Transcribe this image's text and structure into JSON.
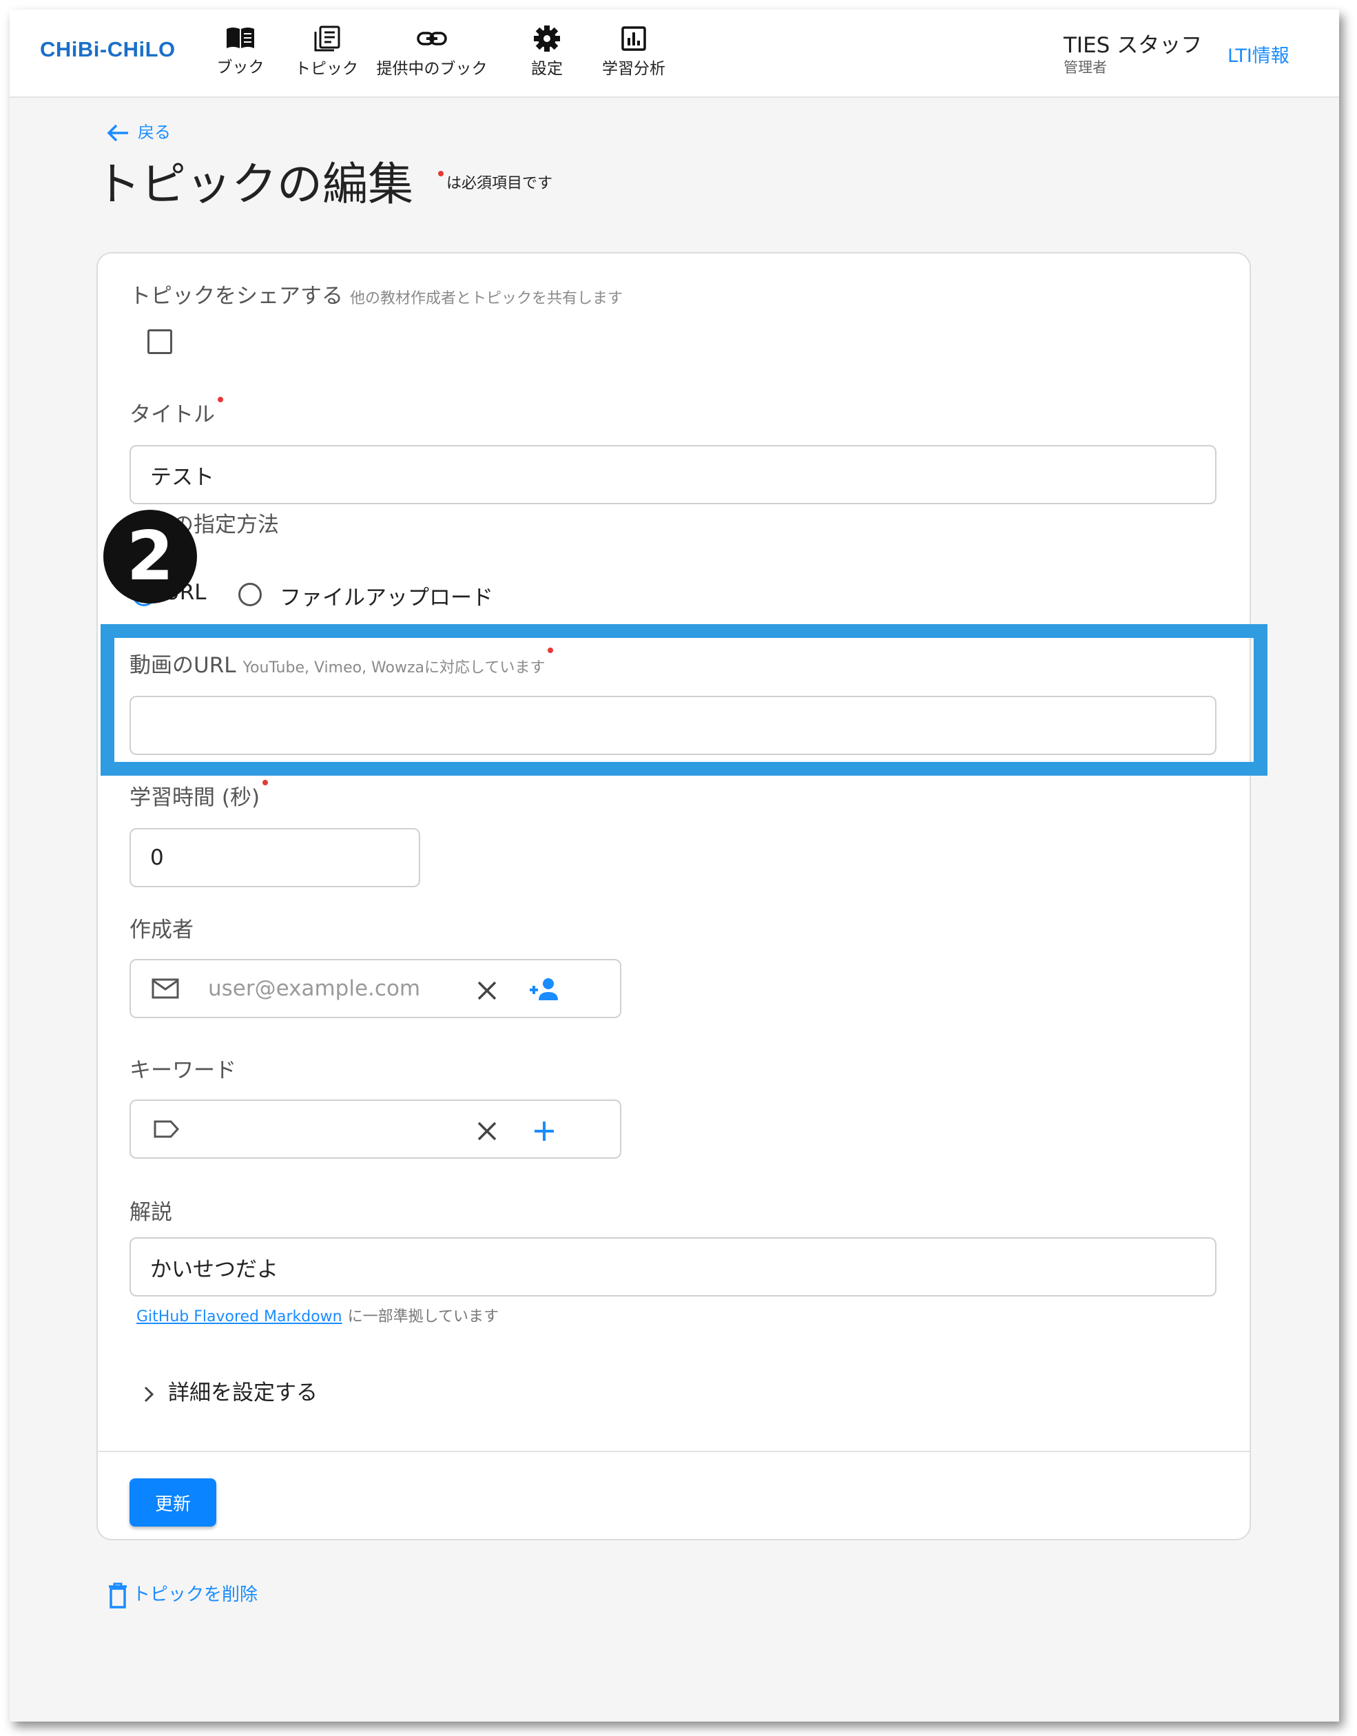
{
  "header": {
    "logo": "CHiBi-CHiLO",
    "nav": [
      {
        "label": "ブック",
        "icon": "book-icon"
      },
      {
        "label": "トピック",
        "icon": "topic-icon"
      },
      {
        "label": "提供中のブック",
        "icon": "link-icon"
      },
      {
        "label": "設定",
        "icon": "gear-icon"
      },
      {
        "label": "学習分析",
        "icon": "analytics-icon"
      }
    ],
    "user_name": "TIES スタッフ",
    "user_role": "管理者",
    "lti_link": "LTI情報"
  },
  "page": {
    "back_label": "戻る",
    "title": "トピックの編集",
    "required_note": "は必須項目です"
  },
  "form": {
    "share": {
      "label": "トピックをシェアする",
      "help": "他の教材作成者とトピックを共有します",
      "checked": false
    },
    "title": {
      "label": "タイトル",
      "value": "テスト"
    },
    "video_method": {
      "label": "動画の指定方法",
      "options": [
        "URL",
        "ファイルアップロード"
      ],
      "selected": "URL"
    },
    "video_url": {
      "label": "動画のURL",
      "help": "YouTube, Vimeo, Wowzaに対応しています",
      "value": ""
    },
    "duration": {
      "label": "学習時間 (秒)",
      "value": "0"
    },
    "author": {
      "label": "作成者",
      "placeholder": "user@example.com"
    },
    "keywords": {
      "label": "キーワード",
      "value": ""
    },
    "description": {
      "label": "解説",
      "value": "かいせつだよ",
      "note_link": "GitHub Flavored Markdown",
      "note_text": "に一部準拠しています"
    },
    "details_label": "詳細を設定する",
    "submit_label": "更新"
  },
  "delete_label": "トピックを削除",
  "annotation": {
    "badge": "2",
    "highlight_color": "#2f9be0"
  },
  "colors": {
    "accent": "#1a8cff",
    "logo": "#1b6fc9",
    "required": "#e53935",
    "button": "#0a84ff"
  }
}
